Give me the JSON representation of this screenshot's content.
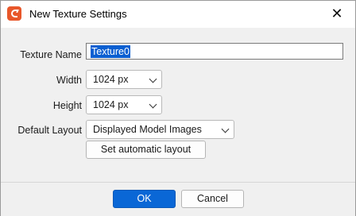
{
  "window": {
    "title": "New Texture Settings",
    "close_glyph": "✕"
  },
  "form": {
    "texture_name": {
      "label": "Texture Name",
      "value": "Texture0"
    },
    "width": {
      "label": "Width",
      "value": "1024 px"
    },
    "height": {
      "label": "Height",
      "value": "1024 px"
    },
    "default_layout": {
      "label": "Default Layout",
      "value": "Displayed Model Images"
    },
    "auto_layout_button": "Set automatic layout"
  },
  "footer": {
    "ok_label": "OK",
    "cancel_label": "Cancel"
  },
  "icons": {
    "app": "app-logo-icon",
    "close": "close-icon",
    "dropdown": "chevron-down-icon"
  },
  "colors": {
    "accent": "#0a67d6",
    "app_logo": "#e8572a"
  }
}
